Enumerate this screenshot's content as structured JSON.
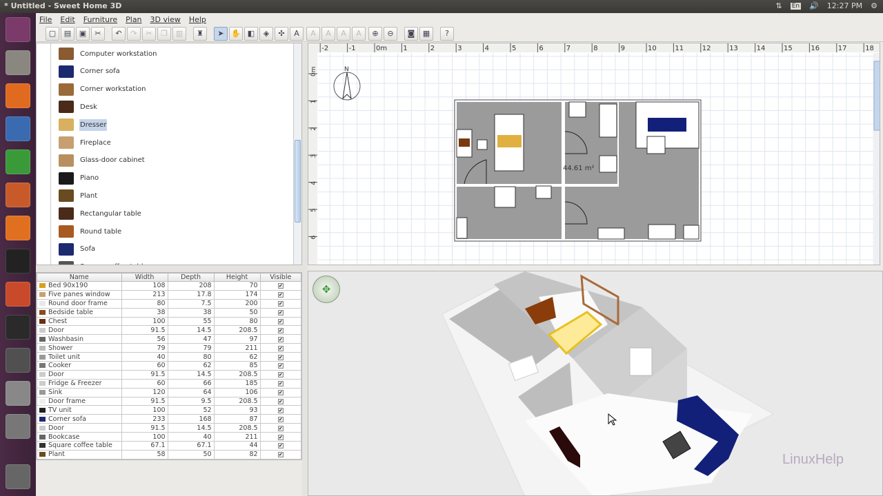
{
  "window": {
    "title": "* Untitled - Sweet Home 3D"
  },
  "tray": {
    "keyboard": "En",
    "time": "12:27 PM",
    "icons": [
      "network-icon",
      "volume-icon",
      "gear-icon"
    ]
  },
  "launcher": {
    "icons": [
      "ubuntu-dash-icon",
      "files-icon",
      "firefox-icon",
      "writer-icon",
      "calc-icon",
      "impress-icon",
      "software-center-icon",
      "amazon-icon",
      "system-settings-icon",
      "terminal-icon",
      "software-updater-icon",
      "sweet-home-3d-icon",
      "disk-icon",
      "trash-icon"
    ]
  },
  "menu": [
    "File",
    "Edit",
    "Furniture",
    "Plan",
    "3D view",
    "Help"
  ],
  "toolbar": [
    {
      "icon": "new-icon",
      "g": "▢"
    },
    {
      "icon": "open-icon",
      "g": "▤"
    },
    {
      "icon": "save-icon",
      "g": "▣"
    },
    {
      "icon": "preferences-icon",
      "g": "✂"
    },
    {
      "icon": "undo-icon",
      "g": "↶"
    },
    {
      "icon": "redo-icon",
      "g": "↷",
      "disabled": true
    },
    {
      "icon": "cut-icon",
      "g": "✂",
      "disabled": true
    },
    {
      "icon": "copy-icon",
      "g": "❐",
      "disabled": true
    },
    {
      "icon": "paste-icon",
      "g": "▥",
      "disabled": true
    },
    {
      "icon": "add-furniture-icon",
      "g": "♜"
    },
    {
      "icon": "select-icon",
      "g": "➤",
      "selected": true
    },
    {
      "icon": "pan-icon",
      "g": "✋"
    },
    {
      "icon": "create-walls-icon",
      "g": "◧"
    },
    {
      "icon": "create-rooms-icon",
      "g": "◈"
    },
    {
      "icon": "create-dimensions-icon",
      "g": "✣"
    },
    {
      "icon": "add-text-icon",
      "g": "A"
    },
    {
      "icon": "text-style-1-icon",
      "g": "A",
      "disabled": true
    },
    {
      "icon": "text-style-2-icon",
      "g": "A",
      "disabled": true
    },
    {
      "icon": "bold-icon",
      "g": "A",
      "disabled": true
    },
    {
      "icon": "italic-icon",
      "g": "A",
      "disabled": true
    },
    {
      "icon": "zoom-in-icon",
      "g": "⊕"
    },
    {
      "icon": "zoom-out-icon",
      "g": "⊖"
    },
    {
      "icon": "create-photo-icon",
      "g": "◙"
    },
    {
      "icon": "create-video-icon",
      "g": "▦"
    },
    {
      "icon": "help-icon",
      "g": "?"
    }
  ],
  "catalog": {
    "items": [
      {
        "label": "Computer workstation",
        "color": "#8a5a30"
      },
      {
        "label": "Corner sofa",
        "color": "#1c2a70"
      },
      {
        "label": "Corner workstation",
        "color": "#9a6a3a"
      },
      {
        "label": "Desk",
        "color": "#4a2a18"
      },
      {
        "label": "Dresser",
        "color": "#d8b060",
        "selected": true
      },
      {
        "label": "Fireplace",
        "color": "#c8a070"
      },
      {
        "label": "Glass-door cabinet",
        "color": "#b89060"
      },
      {
        "label": "Piano",
        "color": "#1a1a1a"
      },
      {
        "label": "Plant",
        "color": "#6a4a20"
      },
      {
        "label": "Rectangular table",
        "color": "#4a2a18"
      },
      {
        "label": "Round table",
        "color": "#a85a20"
      },
      {
        "label": "Sofa",
        "color": "#1c2a70"
      },
      {
        "label": "Square coffee table",
        "color": "#555"
      }
    ]
  },
  "furniture_table": {
    "columns": [
      "Name",
      "Width",
      "Depth",
      "Height",
      "Visible"
    ],
    "rows": [
      [
        "Bed 90x190",
        "108",
        "208",
        "70",
        true,
        "#d8a020"
      ],
      [
        "Five panes window",
        "213",
        "17.8",
        "174",
        true,
        "#c8a070"
      ],
      [
        "Round door frame",
        "80",
        "7.5",
        "200",
        true,
        "#e8e8e8"
      ],
      [
        "Bedside table",
        "38",
        "38",
        "50",
        true,
        "#8a4a20"
      ],
      [
        "Chest",
        "100",
        "55",
        "80",
        true,
        "#6a3010"
      ],
      [
        "Door",
        "91.5",
        "14.5",
        "208.5",
        true,
        "#ccc"
      ],
      [
        "Washbasin",
        "56",
        "47",
        "97",
        true,
        "#666"
      ],
      [
        "Shower",
        "79",
        "79",
        "211",
        true,
        "#bbb"
      ],
      [
        "Toilet unit",
        "40",
        "80",
        "62",
        true,
        "#999"
      ],
      [
        "Cooker",
        "60",
        "62",
        "85",
        true,
        "#777"
      ],
      [
        "Door",
        "91.5",
        "14.5",
        "208.5",
        true,
        "#ccc"
      ],
      [
        "Fridge & Freezer",
        "60",
        "66",
        "185",
        true,
        "#ccc"
      ],
      [
        "Sink",
        "120",
        "64",
        "106",
        true,
        "#999"
      ],
      [
        "Door frame",
        "91.5",
        "9.5",
        "208.5",
        true,
        "#eee"
      ],
      [
        "TV unit",
        "100",
        "52",
        "93",
        true,
        "#222"
      ],
      [
        "Corner sofa",
        "233",
        "168",
        "87",
        true,
        "#1c2a70"
      ],
      [
        "Door",
        "91.5",
        "14.5",
        "208.5",
        true,
        "#ccc"
      ],
      [
        "Bookcase",
        "100",
        "40",
        "211",
        true,
        "#666"
      ],
      [
        "Square coffee table",
        "67.1",
        "67.1",
        "44",
        true,
        "#333"
      ],
      [
        "Plant",
        "58",
        "50",
        "82",
        true,
        "#6a4a20"
      ]
    ]
  },
  "plan": {
    "ruler_x": [
      "-2",
      "-1",
      "0m",
      "1",
      "2",
      "3",
      "4",
      "5",
      "6",
      "7",
      "8",
      "9",
      "10",
      "11",
      "12",
      "13",
      "14",
      "15",
      "16",
      "17",
      "18"
    ],
    "ruler_y": [
      "0m",
      "1",
      "2",
      "3",
      "4",
      "5",
      "6"
    ],
    "compass_label": "N",
    "room_area": "44.61 m²",
    "floor_color": "#9b9b9b"
  },
  "view3d": {
    "navigator_icon": "navigation-arrows-icon",
    "watermark": "LinuxHelp"
  }
}
